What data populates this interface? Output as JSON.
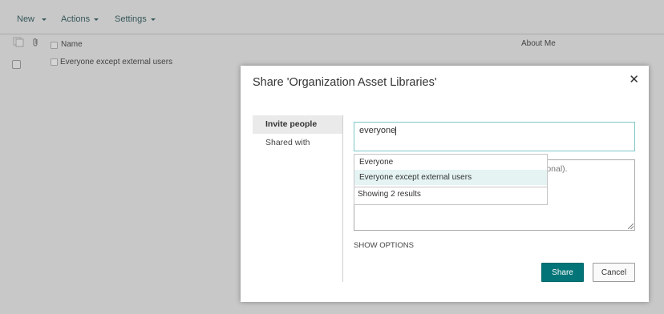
{
  "toolbar": {
    "new_label": "New",
    "actions_label": "Actions",
    "settings_label": "Settings"
  },
  "list": {
    "columns": {
      "name": "Name",
      "about_me": "About Me"
    },
    "rows": [
      {
        "name": "Everyone except external users"
      }
    ]
  },
  "dialog": {
    "title": "Share 'Organization Asset Libraries'",
    "close_glyph": "✕",
    "nav": {
      "invite": "Invite people",
      "shared_with": "Shared with"
    },
    "invite_value": "everyone",
    "message_visible_fragment": "ional).",
    "suggestions": [
      "Everyone",
      "Everyone except external users"
    ],
    "suggestion_footer": "Showing 2 results",
    "show_options": "SHOW OPTIONS",
    "share_label": "Share",
    "cancel_label": "Cancel"
  },
  "colors": {
    "accent": "#037578",
    "input_focus_border": "#7fc7c7",
    "highlight": "#e5f3f3",
    "overlay_bg": "#c8c8c8"
  },
  "icons": [
    "file-icon",
    "attachment-icon",
    "close-icon",
    "chevron-down-icon"
  ]
}
